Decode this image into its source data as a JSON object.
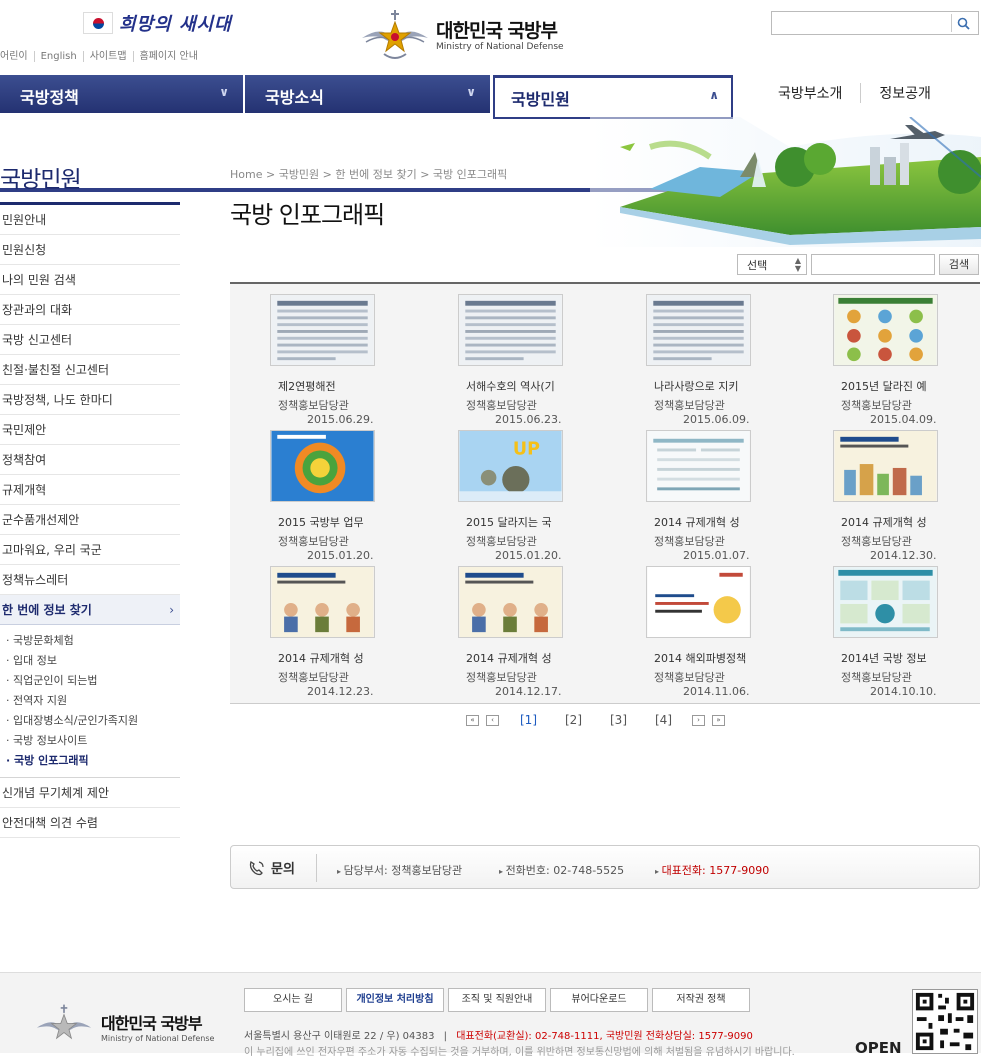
{
  "header": {
    "slogan": "희망의 새시대",
    "util_links": [
      "어린이",
      "English",
      "사이트맵",
      "홈페이지 안내"
    ],
    "logo_title": "대한민국 국방부",
    "logo_sub": "Ministry of National Defense",
    "search_placeholder": ""
  },
  "gnb": {
    "items": [
      {
        "label": "국방정책",
        "chevron": "∨"
      },
      {
        "label": "국방소식",
        "chevron": "∨"
      },
      {
        "label": "국방민원",
        "chevron": "∧"
      }
    ],
    "right_links": [
      "국방부소개",
      "정보공개"
    ]
  },
  "lnb": {
    "title": "국방민원",
    "items": [
      "민원안내",
      "민원신청",
      "나의 민원 검색",
      "장관과의 대화",
      "국방 신고센터",
      "친절·불친절 신고센터",
      "국방정책, 나도 한마디",
      "국민제안",
      "정책참여",
      "규제개혁",
      "군수품개선제안",
      "고마워요, 우리 국군",
      "정책뉴스레터"
    ],
    "active_item": "한 번에 정보 찾기",
    "active_arrow": "›",
    "sub_items": [
      {
        "label": "· 국방문화체험",
        "on": false
      },
      {
        "label": "· 입대 정보",
        "on": false
      },
      {
        "label": "· 직업군인이 되는법",
        "on": false
      },
      {
        "label": "· 전역자 지원",
        "on": false
      },
      {
        "label": "· 입대장병소식/군인가족지원",
        "on": false
      },
      {
        "label": "· 국방 정보사이트",
        "on": false
      },
      {
        "label": "· 국방 인포그래픽",
        "on": true
      }
    ],
    "after_items": [
      "신개념 무기체계 제안",
      "안전대책 의견 수렴"
    ]
  },
  "content": {
    "breadcrumb": "Home > 국방민원 > 한 번에 정보 찾기 > 국방 인포그래픽",
    "title": "국방 인포그래픽",
    "select_label": "선택",
    "search_button": "검색"
  },
  "gallery": [
    {
      "title": "제2연평해전",
      "dept": "정책홍보담당관",
      "date": "2015.06.29.",
      "thumb": "doc-gray"
    },
    {
      "title": "서해수호의 역사(기",
      "dept": "정책홍보담당관",
      "date": "2015.06.23.",
      "thumb": "doc-gray"
    },
    {
      "title": "나라사랑으로 지키",
      "dept": "정책홍보담당관",
      "date": "2015.06.09.",
      "thumb": "doc-gray"
    },
    {
      "title": "2015년 달라진 예",
      "dept": "정책홍보담당관",
      "date": "2015.04.09.",
      "thumb": "grid-color"
    },
    {
      "title": "2015 국방부 업무",
      "dept": "정책홍보담당관",
      "date": "2015.01.20.",
      "thumb": "blue-circle"
    },
    {
      "title": "2015 달라지는 국",
      "dept": "정책홍보담당관",
      "date": "2015.01.20.",
      "thumb": "sky-up"
    },
    {
      "title": "2014 규제개혁 성",
      "dept": "정책홍보담당관",
      "date": "2015.01.07.",
      "thumb": "doc-light"
    },
    {
      "title": "2014 규제개혁 성",
      "dept": "정책홍보담당관",
      "date": "2014.12.30.",
      "thumb": "cream-city"
    },
    {
      "title": "2014 규제개혁 성",
      "dept": "정책홍보담당관",
      "date": "2014.12.23.",
      "thumb": "cream-people"
    },
    {
      "title": "2014 규제개혁 성",
      "dept": "정책홍보담당관",
      "date": "2014.12.17.",
      "thumb": "cream-people"
    },
    {
      "title": "2014 해외파병정책",
      "dept": "정책홍보담당관",
      "date": "2014.11.06.",
      "thumb": "white-text"
    },
    {
      "title": "2014년 국방 정보",
      "dept": "정책홍보담당관",
      "date": "2014.10.10.",
      "thumb": "grid-teal"
    }
  ],
  "paging": {
    "first": "«",
    "prev": "‹",
    "next": "›",
    "last": "»",
    "pages": [
      "[1]",
      "[2]",
      "[3]",
      "[4]"
    ],
    "current": "[1]"
  },
  "inquiry": {
    "label": "문의",
    "dept": "담당부서: 정책홍보담당관",
    "phone": "전화번호: 02-748-5525",
    "main_phone": "대표전화: 1577-9090",
    "main_phone_color": "#c00000"
  },
  "footer": {
    "logo_title": "대한민국 국방부",
    "logo_sub": "Ministry of National Defense",
    "links": [
      "오시는 길",
      "개인정보 처리방침",
      "조직 및 직원안내",
      "뷰어다운로드",
      "저작권 정책"
    ],
    "address": "서울특별시 용산구 이태원로 22 / 우) 04383",
    "phones": "대표전화(교환실): 02-748-1111, 국방민원 전화상담실: 1577-9090",
    "notice": "이 누리집에 쓰인 전자우편 주소가 자동 수집되는 것을 거부하며, 이를 위반하면 정보통신망법에 의해 처벌됨을 유념하시기 바랍니다.",
    "open_logo": "OPEN"
  },
  "colors": {
    "navy": "#1d2a6e",
    "gnb_dark": "#2f3e86",
    "accent_red": "#c00000"
  }
}
